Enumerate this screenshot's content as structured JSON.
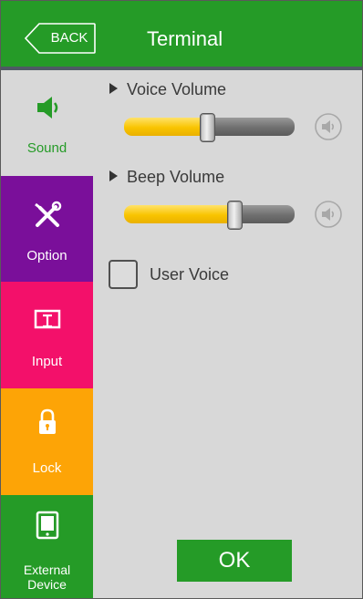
{
  "header": {
    "back_label": "BACK",
    "title": "Terminal",
    "background_color": "#259b27"
  },
  "sidebar": {
    "items": [
      {
        "label": "Sound",
        "icon": "speaker-icon",
        "color": "#d8d8d8",
        "text_color": "#259b27",
        "selected": true
      },
      {
        "label": "Option",
        "icon": "tools-icon",
        "color": "#7a0f9a",
        "text_color": "#ffffff",
        "selected": false
      },
      {
        "label": "Input",
        "icon": "monitor-input-icon",
        "color": "#f3106a",
        "text_color": "#ffffff",
        "selected": false
      },
      {
        "label": "Lock",
        "icon": "padlock-icon",
        "color": "#fda406",
        "text_color": "#ffffff",
        "selected": false
      },
      {
        "label_line1": "External",
        "label_line2": "Device",
        "icon": "tablet-icon",
        "color": "#259b27",
        "text_color": "#ffffff",
        "selected": false
      }
    ]
  },
  "sound": {
    "voice_volume": {
      "label": "Voice Volume",
      "level": 0.49,
      "mute_icon": "speaker-mute-icon"
    },
    "beep_volume": {
      "label": "Beep Volume",
      "level": 0.65,
      "mute_icon": "speaker-mute-icon"
    },
    "user_voice": {
      "label": "User Voice",
      "checked": false
    }
  },
  "ok_label": "OK"
}
